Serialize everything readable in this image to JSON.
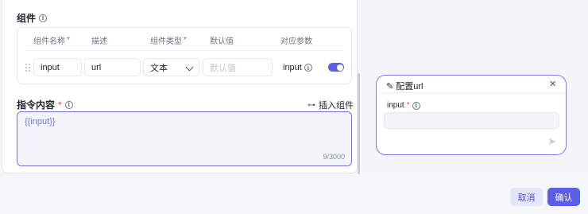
{
  "components_section": {
    "title": "组件"
  },
  "table": {
    "headers": [
      {
        "label": "组件名称",
        "required": "*"
      },
      {
        "label": "描述",
        "required": ""
      },
      {
        "label": "组件类型",
        "required": "*"
      },
      {
        "label": "默认值",
        "required": ""
      },
      {
        "label": "对应参数",
        "required": ""
      }
    ],
    "row": {
      "name": "input",
      "description": "url",
      "type": "文本",
      "default_placeholder": "默认值",
      "param": "input",
      "enabled": true
    }
  },
  "instruction_section": {
    "title": "指令内容",
    "required": "*",
    "insert_label": "插入组件",
    "content": "{{input}}",
    "counter": "9/3000"
  },
  "popup": {
    "title": "配置url",
    "field_label": "input",
    "field_required": "*",
    "field_value": "",
    "icons": {
      "title": "wand-icon",
      "close": "close-icon",
      "send": "send-icon"
    }
  },
  "footer": {
    "cancel_label": "取消",
    "confirm_label": "确认"
  },
  "colors": {
    "accent": "#5b5fe8",
    "required": "#f53f3f"
  }
}
